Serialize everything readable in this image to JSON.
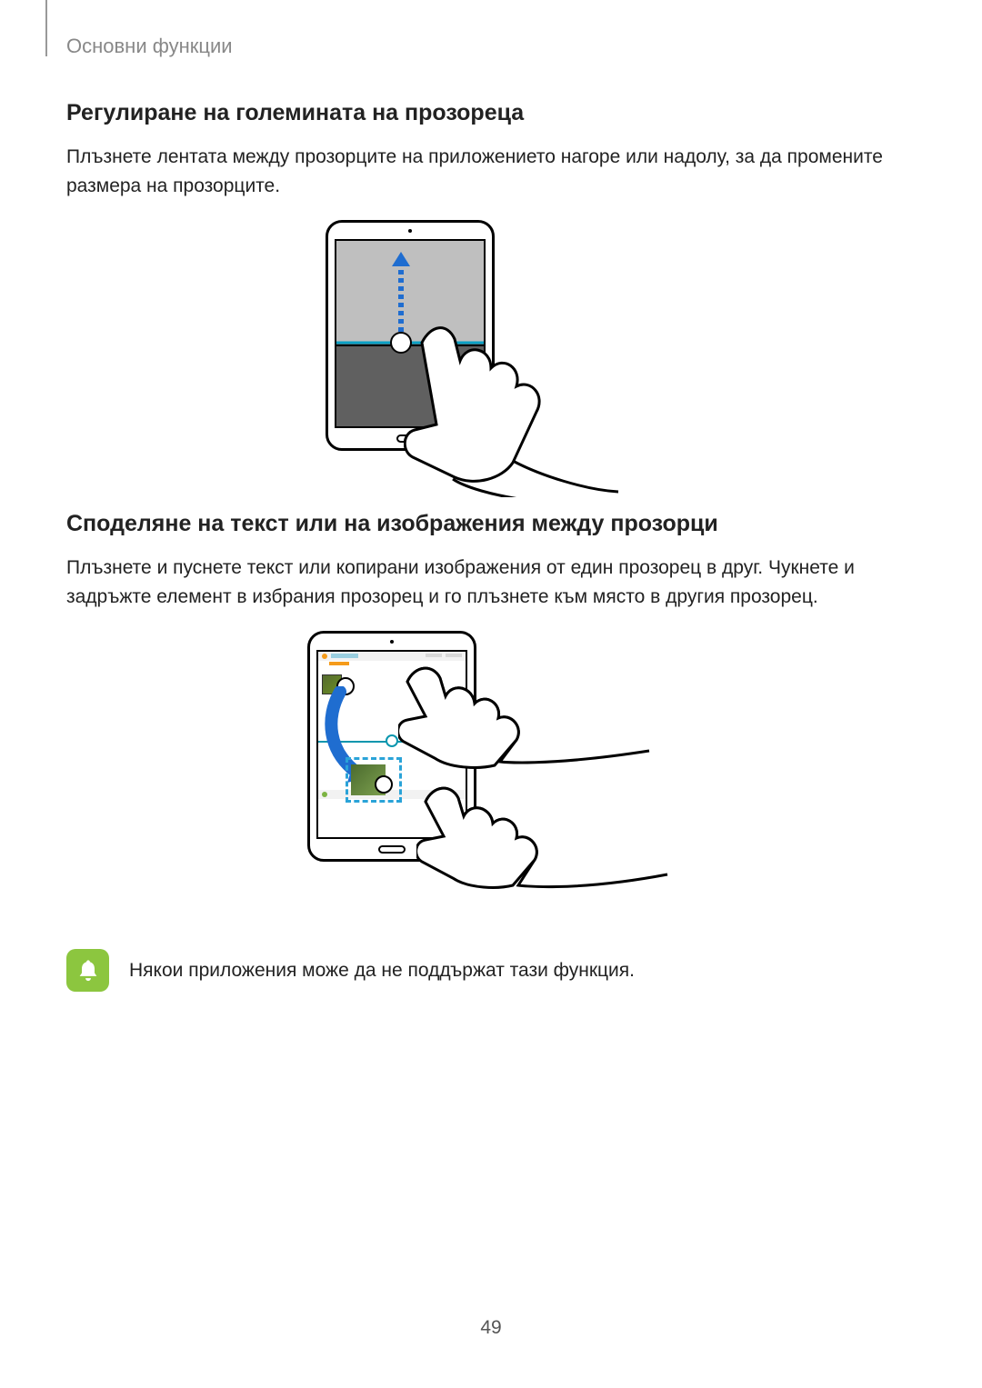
{
  "breadcrumb": "Основни функции",
  "section1": {
    "heading": "Регулиране на големината на прозореца",
    "body": "Плъзнете лентата между прозорците на приложението нагоре или надолу, за да промените размера на прозорците."
  },
  "section2": {
    "heading": "Споделяне на текст или на изображения между прозорци",
    "body": "Плъзнете и пуснете текст или копирани изображения от един прозорец в друг. Чукнете и задръжте елемент в избрания прозорец и го плъзнете към място в другия прозорец."
  },
  "note": {
    "text": "Някои приложения може да не поддържат тази функция."
  },
  "page_number": "49"
}
